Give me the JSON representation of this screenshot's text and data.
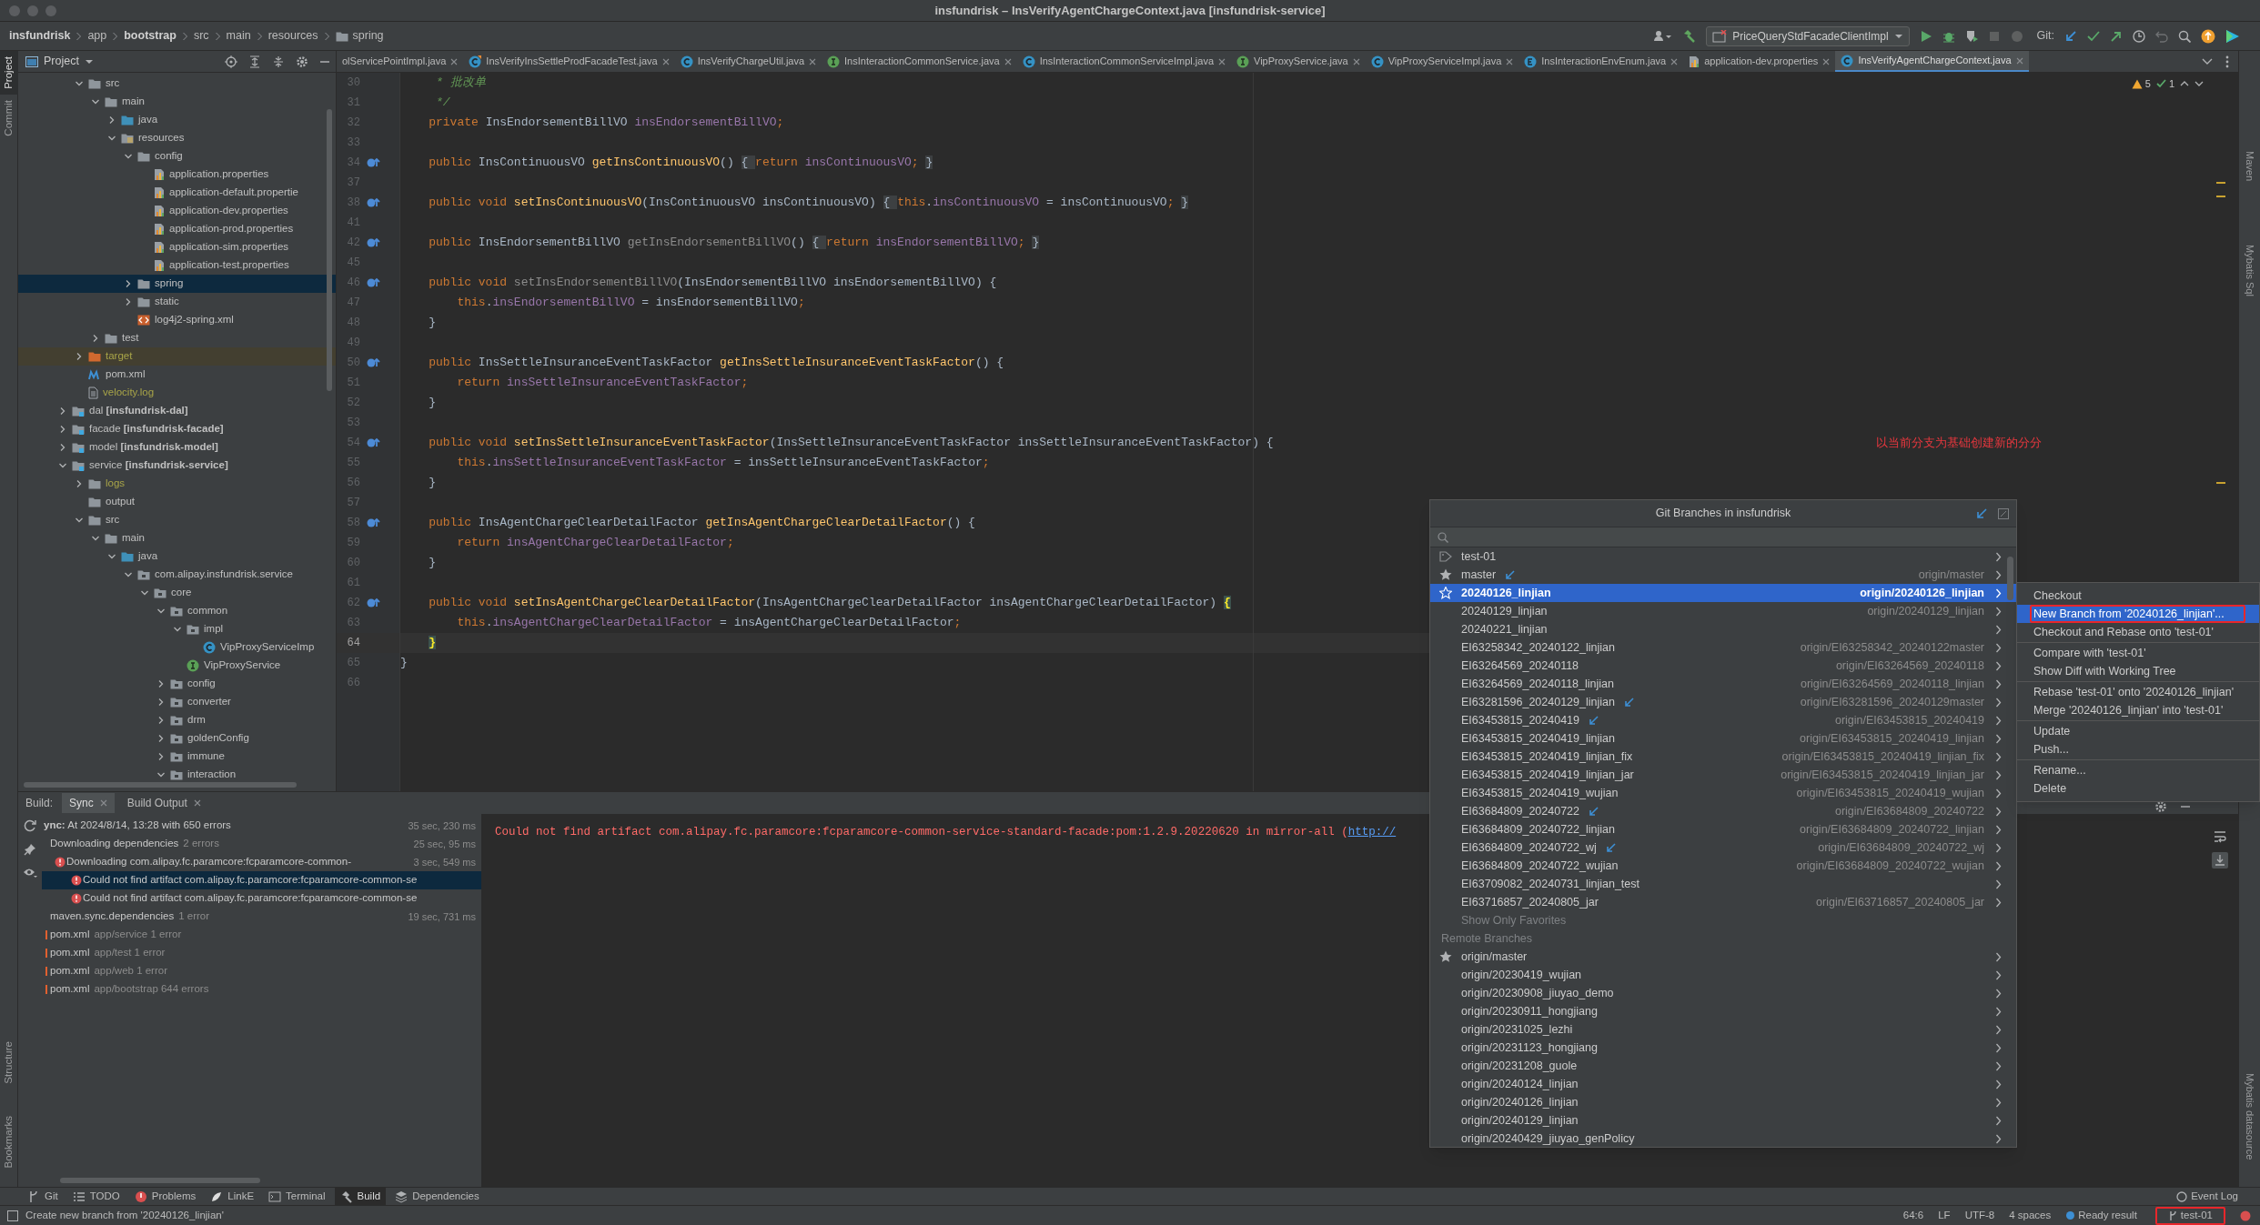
{
  "window": {
    "title": "insfundrisk – InsVerifyAgentChargeContext.java [insfundrisk-service]"
  },
  "breadcrumbs": [
    {
      "label": "insfundrisk",
      "bold": true,
      "kind": "text"
    },
    {
      "label": "app",
      "bold": false,
      "kind": "text"
    },
    {
      "label": "bootstrap",
      "bold": true,
      "kind": "text"
    },
    {
      "label": "src",
      "bold": false,
      "kind": "text"
    },
    {
      "label": "main",
      "bold": false,
      "kind": "text"
    },
    {
      "label": "resources",
      "bold": false,
      "kind": "text"
    },
    {
      "label": "spring",
      "bold": false,
      "kind": "folder"
    }
  ],
  "toolbar": {
    "run_configuration": "PriceQueryStdFacadeClientImpl",
    "git_label": "Git:"
  },
  "left_strip": [
    {
      "label": "Project",
      "selected": true
    },
    {
      "label": "Commit",
      "selected": false
    }
  ],
  "left_strip_bottom": [
    {
      "label": "Structure"
    },
    {
      "label": "Bookmarks"
    }
  ],
  "right_strip": [
    {
      "label": "Maven"
    },
    {
      "label": "Mybatis Sql"
    }
  ],
  "right_strip_bottom": [
    {
      "label": "Mybatis datasource"
    }
  ],
  "project_panel": {
    "title": "Project",
    "scrolled_parent_items": [
      {
        "label": "src",
        "kind": "folder",
        "expanded": true,
        "selected": false,
        "ignored": false,
        "children": [
          {
            "label": "main",
            "kind": "folder",
            "expanded": true,
            "selected": false,
            "ignored": false,
            "children": [
              {
                "label": "java",
                "kind": "source_folder",
                "expanded": false,
                "selected": false,
                "ignored": false
              },
              {
                "label": "resources",
                "kind": "resource_folder",
                "expanded": true,
                "selected": false,
                "ignored": false,
                "children": [
                  {
                    "label": "config",
                    "kind": "folder",
                    "expanded": true,
                    "selected": false,
                    "ignored": false,
                    "children": [
                      {
                        "label": "application.properties",
                        "kind": "properties",
                        "selected": false,
                        "ignored": false
                      },
                      {
                        "label": "application-default.propertie",
                        "kind": "properties",
                        "selected": false,
                        "ignored": false
                      },
                      {
                        "label": "application-dev.properties",
                        "kind": "properties",
                        "selected": false,
                        "ignored": false
                      },
                      {
                        "label": "application-prod.properties",
                        "kind": "properties",
                        "selected": false,
                        "ignored": false
                      },
                      {
                        "label": "application-sim.properties",
                        "kind": "properties",
                        "selected": false,
                        "ignored": false
                      },
                      {
                        "label": "application-test.properties",
                        "kind": "properties",
                        "selected": false,
                        "ignored": false
                      }
                    ]
                  },
                  {
                    "label": "spring",
                    "kind": "folder",
                    "expanded": false,
                    "selected": true,
                    "ignored": false
                  },
                  {
                    "label": "static",
                    "kind": "folder",
                    "expanded": false,
                    "selected": false,
                    "ignored": false
                  },
                  {
                    "label": "log4j2-spring.xml",
                    "kind": "xml",
                    "selected": false,
                    "ignored": false
                  }
                ]
              }
            ]
          },
          {
            "label": "test",
            "kind": "folder",
            "expanded": false,
            "selected": false,
            "ignored": false
          }
        ]
      },
      {
        "label": "target",
        "kind": "excluded_folder",
        "expanded": false,
        "selected": false,
        "ignored": true
      },
      {
        "label": "pom.xml",
        "kind": "maven",
        "selected": false,
        "ignored": false
      },
      {
        "label": "velocity.log",
        "kind": "log",
        "selected": false,
        "ignored": true
      }
    ],
    "items": [
      {
        "label": "dal **[insfundrisk-dal]**",
        "kind": "module",
        "expanded": false,
        "selected": false,
        "ignored": false
      },
      {
        "label": "facade **[insfundrisk-facade]**",
        "kind": "module",
        "expanded": false,
        "selected": false,
        "ignored": false
      },
      {
        "label": "model **[insfundrisk-model]**",
        "kind": "module",
        "expanded": false,
        "selected": false,
        "ignored": false
      },
      {
        "label": "service **[insfundrisk-service]**",
        "kind": "module",
        "expanded": true,
        "selected": false,
        "ignored": false,
        "children": [
          {
            "label": "logs",
            "kind": "folder",
            "expanded": false,
            "selected": false,
            "ignored": true
          },
          {
            "label": "output",
            "kind": "folder",
            "selected": false,
            "ignored": false
          },
          {
            "label": "src",
            "kind": "folder",
            "expanded": true,
            "selected": false,
            "ignored": false,
            "children": [
              {
                "label": "main",
                "kind": "folder",
                "expanded": true,
                "selected": false,
                "ignored": false,
                "children": [
                  {
                    "label": "java",
                    "kind": "source_folder",
                    "expanded": true,
                    "selected": false,
                    "ignored": false,
                    "children": [
                      {
                        "label": "com.alipay.insfundrisk.service",
                        "kind": "package",
                        "expanded": true,
                        "selected": false,
                        "ignored": false,
                        "children": [
                          {
                            "label": "core",
                            "kind": "package",
                            "expanded": true,
                            "selected": false,
                            "ignored": false,
                            "children": [
                              {
                                "label": "common",
                                "kind": "package",
                                "expanded": true,
                                "selected": false,
                                "ignored": false,
                                "children": [
                                  {
                                    "label": "impl",
                                    "kind": "package",
                                    "expanded": true,
                                    "selected": false,
                                    "ignored": false,
                                    "children": [
                                      {
                                        "label": "VipProxyServiceImp",
                                        "kind": "class",
                                        "selected": false,
                                        "ignored": false
                                      }
                                    ]
                                  },
                                  {
                                    "label": "VipProxyService",
                                    "kind": "interface",
                                    "selected": false,
                                    "ignored": false
                                  }
                                ]
                              },
                              {
                                "label": "config",
                                "kind": "package",
                                "expanded": false,
                                "selected": false,
                                "ignored": false
                              },
                              {
                                "label": "converter",
                                "kind": "package",
                                "expanded": false,
                                "selected": false,
                                "ignored": false
                              },
                              {
                                "label": "drm",
                                "kind": "package",
                                "expanded": false,
                                "selected": false,
                                "ignored": false
                              },
                              {
                                "label": "goldenConfig",
                                "kind": "package",
                                "expanded": false,
                                "selected": false,
                                "ignored": false
                              },
                              {
                                "label": "immune",
                                "kind": "package",
                                "expanded": false,
                                "selected": false,
                                "ignored": false
                              },
                              {
                                "label": "interaction",
                                "kind": "package",
                                "expanded": true,
                                "selected": false,
                                "ignored": false
                              }
                            ]
                          }
                        ]
                      }
                    ]
                  }
                ]
              }
            ]
          }
        ]
      }
    ]
  },
  "editor": {
    "tabs": [
      {
        "label": "olServicePointImpl.java",
        "kind": "none",
        "selected": false
      },
      {
        "label": "InsVerifyInsSettleProdFacadeTest.java",
        "kind": "test_class",
        "selected": false
      },
      {
        "label": "InsVerifyChargeUtil.java",
        "kind": "class",
        "selected": false
      },
      {
        "label": "InsInteractionCommonService.java",
        "kind": "interface",
        "selected": false
      },
      {
        "label": "InsInteractionCommonServiceImpl.java",
        "kind": "class",
        "selected": false
      },
      {
        "label": "VipProxyService.java",
        "kind": "interface",
        "selected": false
      },
      {
        "label": "VipProxyServiceImpl.java",
        "kind": "class",
        "selected": false
      },
      {
        "label": "InsInteractionEnvEnum.java",
        "kind": "enum",
        "selected": false
      },
      {
        "label": "application-dev.properties",
        "kind": "properties",
        "selected": false
      },
      {
        "label": "InsVerifyAgentChargeContext.java",
        "kind": "class",
        "selected": true
      }
    ],
    "inspections": {
      "warnings": "5",
      "passed": "1"
    },
    "lines": [
      {
        "n": "30",
        "marker": false,
        "current": false,
        "tokens": [
          {
            "kind": "c",
            "text": "     * 批改单"
          }
        ]
      },
      {
        "n": "31",
        "marker": false,
        "current": false,
        "tokens": [
          {
            "kind": "c",
            "text": "     */"
          }
        ]
      },
      {
        "n": "32",
        "marker": false,
        "current": false,
        "tokens": [
          {
            "kind": "k",
            "text": "    private "
          },
          {
            "kind": "t",
            "text": "InsEndorsementBillVO "
          },
          {
            "kind": "f",
            "text": "insEndorsementBillVO"
          },
          {
            "kind": "k",
            "text": ";"
          }
        ]
      },
      {
        "n": "33",
        "marker": false,
        "current": false
      },
      {
        "n": "34",
        "marker": true,
        "current": false,
        "tokens": [
          {
            "kind": "k",
            "text": "    public "
          },
          {
            "kind": "t",
            "text": "InsContinuousVO "
          },
          {
            "kind": "m",
            "text": "getInsContinuousVO"
          },
          {
            "kind": "t",
            "text": "() "
          },
          {
            "kind": "fb",
            "text": "{ "
          },
          {
            "kind": "k",
            "text": "return "
          },
          {
            "kind": "f",
            "text": "insContinuousVO"
          },
          {
            "kind": "k",
            "text": ";"
          },
          {
            "kind": "fb",
            "text": " }"
          }
        ]
      },
      {
        "n": "37",
        "marker": false,
        "current": false
      },
      {
        "n": "38",
        "marker": true,
        "current": false,
        "tokens": [
          {
            "kind": "k",
            "text": "    public void "
          },
          {
            "kind": "m",
            "text": "setInsContinuousVO"
          },
          {
            "kind": "t",
            "text": "(InsContinuousVO insContinuousVO) "
          },
          {
            "kind": "fb",
            "text": "{ "
          },
          {
            "kind": "k",
            "text": "this"
          },
          {
            "kind": "t",
            "text": "."
          },
          {
            "kind": "f",
            "text": "insContinuousVO"
          },
          {
            "kind": "t",
            "text": " = insContinuousVO"
          },
          {
            "kind": "k",
            "text": ";"
          },
          {
            "kind": "fb",
            "text": " }"
          }
        ]
      },
      {
        "n": "41",
        "marker": false,
        "current": false
      },
      {
        "n": "42",
        "marker": true,
        "current": false,
        "tokens": [
          {
            "kind": "k",
            "text": "    public "
          },
          {
            "kind": "t",
            "text": "InsEndorsementBillVO "
          },
          {
            "kind": "d",
            "text": "getInsEndorsementBillVO"
          },
          {
            "kind": "t",
            "text": "() "
          },
          {
            "kind": "fb",
            "text": "{ "
          },
          {
            "kind": "k",
            "text": "return "
          },
          {
            "kind": "f",
            "text": "insEndorsementBillVO"
          },
          {
            "kind": "k",
            "text": ";"
          },
          {
            "kind": "fb",
            "text": " }"
          }
        ]
      },
      {
        "n": "45",
        "marker": false,
        "current": false
      },
      {
        "n": "46",
        "marker": true,
        "current": false,
        "tokens": [
          {
            "kind": "k",
            "text": "    public void "
          },
          {
            "kind": "d",
            "text": "setInsEndorsementBillVO"
          },
          {
            "kind": "t",
            "text": "(InsEndorsementBillVO insEndorsementBillVO) {"
          }
        ]
      },
      {
        "n": "47",
        "marker": false,
        "current": false,
        "tokens": [
          {
            "kind": "k",
            "text": "        this"
          },
          {
            "kind": "t",
            "text": "."
          },
          {
            "kind": "f",
            "text": "insEndorsementBillVO"
          },
          {
            "kind": "t",
            "text": " = insEndorsementBillVO"
          },
          {
            "kind": "k",
            "text": ";"
          }
        ]
      },
      {
        "n": "48",
        "marker": false,
        "current": false,
        "tokens": [
          {
            "kind": "t",
            "text": "    }"
          }
        ]
      },
      {
        "n": "49",
        "marker": false,
        "current": false
      },
      {
        "n": "50",
        "marker": true,
        "current": false,
        "tokens": [
          {
            "kind": "k",
            "text": "    public "
          },
          {
            "kind": "t",
            "text": "InsSettleInsuranceEventTaskFactor "
          },
          {
            "kind": "m",
            "text": "getInsSettleInsuranceEventTaskFactor"
          },
          {
            "kind": "t",
            "text": "() {"
          }
        ]
      },
      {
        "n": "51",
        "marker": false,
        "current": false,
        "tokens": [
          {
            "kind": "k",
            "text": "        return "
          },
          {
            "kind": "f",
            "text": "insSettleInsuranceEventTaskFactor"
          },
          {
            "kind": "k",
            "text": ";"
          }
        ]
      },
      {
        "n": "52",
        "marker": false,
        "current": false,
        "tokens": [
          {
            "kind": "t",
            "text": "    }"
          }
        ]
      },
      {
        "n": "53",
        "marker": false,
        "current": false
      },
      {
        "n": "54",
        "marker": true,
        "current": false,
        "tokens": [
          {
            "kind": "k",
            "text": "    public void "
          },
          {
            "kind": "m",
            "text": "setInsSettleInsuranceEventTaskFactor"
          },
          {
            "kind": "t",
            "text": "(InsSettleInsuranceEventTaskFactor insSettleInsuranceEventTaskFactor) {"
          }
        ]
      },
      {
        "n": "55",
        "marker": false,
        "current": false,
        "tokens": [
          {
            "kind": "k",
            "text": "        this"
          },
          {
            "kind": "t",
            "text": "."
          },
          {
            "kind": "f",
            "text": "insSettleInsuranceEventTaskFactor"
          },
          {
            "kind": "t",
            "text": " = insSettleInsuranceEventTaskFactor"
          },
          {
            "kind": "k",
            "text": ";"
          }
        ]
      },
      {
        "n": "56",
        "marker": false,
        "current": false,
        "tokens": [
          {
            "kind": "t",
            "text": "    }"
          }
        ]
      },
      {
        "n": "57",
        "marker": false,
        "current": false
      },
      {
        "n": "58",
        "marker": true,
        "current": false,
        "tokens": [
          {
            "kind": "k",
            "text": "    public "
          },
          {
            "kind": "t",
            "text": "InsAgentChargeClearDetailFactor "
          },
          {
            "kind": "m",
            "text": "getInsAgentChargeClearDetailFactor"
          },
          {
            "kind": "t",
            "text": "() {"
          }
        ]
      },
      {
        "n": "59",
        "marker": false,
        "current": false,
        "tokens": [
          {
            "kind": "k",
            "text": "        return "
          },
          {
            "kind": "f",
            "text": "insAgentChargeClearDetailFactor"
          },
          {
            "kind": "k",
            "text": ";"
          }
        ]
      },
      {
        "n": "60",
        "marker": false,
        "current": false,
        "tokens": [
          {
            "kind": "t",
            "text": "    }"
          }
        ]
      },
      {
        "n": "61",
        "marker": false,
        "current": false
      },
      {
        "n": "62",
        "marker": true,
        "current": false,
        "tokens": [
          {
            "kind": "k",
            "text": "    public void "
          },
          {
            "kind": "m",
            "text": "setInsAgentChargeClearDetailFactor"
          },
          {
            "kind": "t",
            "text": "(InsAgentChargeClearDetailFactor insAgentChargeClearDetailFactor) "
          },
          {
            "kind": "hb",
            "text": "{"
          }
        ]
      },
      {
        "n": "63",
        "marker": false,
        "current": false,
        "tokens": [
          {
            "kind": "k",
            "text": "        this"
          },
          {
            "kind": "t",
            "text": "."
          },
          {
            "kind": "f",
            "text": "insAgentChargeClearDetailFactor"
          },
          {
            "kind": "t",
            "text": " = insAgentChargeClearDetailFactor"
          },
          {
            "kind": "k",
            "text": ";"
          }
        ]
      },
      {
        "n": "64",
        "marker": false,
        "current": true,
        "tokens": [
          {
            "kind": "hb",
            "text": "    }"
          }
        ]
      },
      {
        "n": "65",
        "marker": false,
        "current": false,
        "tokens": [
          {
            "kind": "t",
            "text": "}"
          }
        ]
      },
      {
        "n": "66",
        "marker": false,
        "current": false
      }
    ],
    "annotation": "以当前分支为基础创建新的分分"
  },
  "build": {
    "label": "Build:",
    "tabs": [
      {
        "label": "Sync",
        "selected": true
      },
      {
        "label": "Build Output",
        "selected": false
      }
    ],
    "tree": [
      {
        "label": "**ync:** At 2024/8/14, 13:28 with 650 errors",
        "time": "35 sec, 230 ms",
        "kind": "plain",
        "selected": false,
        "children": [
          {
            "label": "Downloading dependencies",
            "detail": "2 errors",
            "time": "25 sec, 95 ms",
            "kind": "plain",
            "selected": false,
            "children": [
              {
                "label": "Downloading com.alipay.fc.paramcore:fcparamcore-common-",
                "time": "3 sec, 549 ms",
                "kind": "error",
                "selected": false,
                "children": [
                  {
                    "label": "Could not find artifact com.alipay.fc.paramcore:fcparamcore-common-se",
                    "kind": "error",
                    "selected": true
                  },
                  {
                    "label": "Could not find artifact com.alipay.fc.paramcore:fcparamcore-common-se",
                    "kind": "error",
                    "selected": false
                  }
                ]
              }
            ]
          },
          {
            "label": "maven.sync.dependencies",
            "detail": "1 error",
            "time": "19 sec, 731 ms",
            "kind": "plain",
            "selected": false
          },
          {
            "label": "pom.xml",
            "detail": "app/service 1 error",
            "kind": "problem_file",
            "selected": false
          },
          {
            "label": "pom.xml",
            "detail": "app/test 1 error",
            "kind": "problem_file",
            "selected": false
          },
          {
            "label": "pom.xml",
            "detail": "app/web 1 error",
            "kind": "problem_file",
            "selected": false
          },
          {
            "label": "pom.xml",
            "detail": "app/bootstrap 644 errors",
            "kind": "problem_file",
            "selected": false
          }
        ]
      }
    ],
    "console": {
      "message": "Could not find artifact com.alipay.fc.paramcore:fcparamcore-common-service-standard-facade:pom:1.2.9.20220620 in mirror-all (",
      "link": "http://"
    }
  },
  "git_branches_popup": {
    "title": "Git Branches in insfundrisk",
    "local": [
      {
        "label": "test-01",
        "kind": "current",
        "incoming": false,
        "selected": false
      },
      {
        "label": "master",
        "kind": "favorite",
        "incoming": true,
        "tracking": "origin/master",
        "selected": false
      },
      {
        "label": "20240126_linjian",
        "kind": "star_outline",
        "incoming": false,
        "tracking": "origin/20240126_linjian",
        "selected": true
      },
      {
        "label": "20240129_linjian",
        "kind": "plain",
        "incoming": false,
        "tracking": "origin/20240129_linjian",
        "selected": false
      },
      {
        "label": "20240221_linjian",
        "kind": "plain",
        "incoming": false,
        "selected": false
      },
      {
        "label": "EI63258342_20240122_linjian",
        "kind": "plain",
        "incoming": false,
        "tracking": "origin/EI63258342_20240122master",
        "selected": false
      },
      {
        "label": "EI63264569_20240118",
        "kind": "plain",
        "incoming": false,
        "tracking": "origin/EI63264569_20240118",
        "selected": false
      },
      {
        "label": "EI63264569_20240118_linjian",
        "kind": "plain",
        "incoming": false,
        "tracking": "origin/EI63264569_20240118_linjian",
        "selected": false
      },
      {
        "label": "EI63281596_20240129_linjian",
        "kind": "plain",
        "incoming": true,
        "tracking": "origin/EI63281596_20240129master",
        "selected": false
      },
      {
        "label": "EI63453815_20240419",
        "kind": "plain",
        "incoming": true,
        "tracking": "origin/EI63453815_20240419",
        "selected": false
      },
      {
        "label": "EI63453815_20240419_linjian",
        "kind": "plain",
        "incoming": false,
        "tracking": "origin/EI63453815_20240419_linjian",
        "selected": false
      },
      {
        "label": "EI63453815_20240419_linjian_fix",
        "kind": "plain",
        "incoming": false,
        "tracking": "origin/EI63453815_20240419_linjian_fix",
        "selected": false
      },
      {
        "label": "EI63453815_20240419_linjian_jar",
        "kind": "plain",
        "incoming": false,
        "tracking": "origin/EI63453815_20240419_linjian_jar",
        "selected": false
      },
      {
        "label": "EI63453815_20240419_wujian",
        "kind": "plain",
        "incoming": false,
        "tracking": "origin/EI63453815_20240419_wujian",
        "selected": false
      },
      {
        "label": "EI63684809_20240722",
        "kind": "plain",
        "incoming": true,
        "tracking": "origin/EI63684809_20240722",
        "selected": false
      },
      {
        "label": "EI63684809_20240722_linjian",
        "kind": "plain",
        "incoming": false,
        "tracking": "origin/EI63684809_20240722_linjian",
        "selected": false
      },
      {
        "label": "EI63684809_20240722_wj",
        "kind": "plain",
        "incoming": true,
        "tracking": "origin/EI63684809_20240722_wj",
        "selected": false
      },
      {
        "label": "EI63684809_20240722_wujian",
        "kind": "plain",
        "incoming": false,
        "tracking": "origin/EI63684809_20240722_wujian",
        "selected": false
      },
      {
        "label": "EI63709082_20240731_linjian_test",
        "kind": "plain",
        "incoming": false,
        "selected": false
      },
      {
        "label": "EI63716857_20240805_jar",
        "kind": "plain",
        "incoming": false,
        "tracking": "origin/EI63716857_20240805_jar",
        "selected": false
      }
    ],
    "show_only_favorites": "Show Only Favorites",
    "remote_header": "Remote Branches",
    "remote": [
      {
        "label": "origin/master",
        "kind": "favorite",
        "selected": false
      },
      {
        "label": "origin/20230419_wujian",
        "kind": "plain",
        "selected": false
      },
      {
        "label": "origin/20230908_jiuyao_demo",
        "kind": "plain",
        "selected": false
      },
      {
        "label": "origin/20230911_hongjiang",
        "kind": "plain",
        "selected": false
      },
      {
        "label": "origin/20231025_lezhi",
        "kind": "plain",
        "selected": false
      },
      {
        "label": "origin/20231123_hongjiang",
        "kind": "plain",
        "selected": false
      },
      {
        "label": "origin/20231208_guole",
        "kind": "plain",
        "selected": false
      },
      {
        "label": "origin/20240124_linjian",
        "kind": "plain",
        "selected": false
      },
      {
        "label": "origin/20240126_linjian",
        "kind": "plain",
        "selected": false
      },
      {
        "label": "origin/20240129_linjian",
        "kind": "plain",
        "selected": false
      },
      {
        "label": "origin/20240429_jiuyao_genPolicy",
        "kind": "plain",
        "selected": false
      }
    ]
  },
  "branch_menu": [
    {
      "kind": "item",
      "label": "Checkout",
      "selected": false,
      "annotated": false
    },
    {
      "kind": "item",
      "label": "New Branch from '20240126_linjian'...",
      "selected": true,
      "annotated": true
    },
    {
      "kind": "item",
      "label": "Checkout and Rebase onto 'test-01'",
      "selected": false,
      "annotated": false
    },
    {
      "kind": "separator"
    },
    {
      "kind": "item",
      "label": "Compare with 'test-01'",
      "selected": false,
      "annotated": false
    },
    {
      "kind": "item",
      "label": "Show Diff with Working Tree",
      "selected": false,
      "annotated": false
    },
    {
      "kind": "separator"
    },
    {
      "kind": "item",
      "label": "Rebase 'test-01' onto '20240126_linjian'",
      "selected": false,
      "annotated": false
    },
    {
      "kind": "item",
      "label": "Merge '20240126_linjian' into 'test-01'",
      "selected": false,
      "annotated": false
    },
    {
      "kind": "separator"
    },
    {
      "kind": "item",
      "label": "Update",
      "selected": false,
      "annotated": false
    },
    {
      "kind": "item",
      "label": "Push...",
      "selected": false,
      "annotated": false
    },
    {
      "kind": "separator"
    },
    {
      "kind": "item",
      "label": "Rename...",
      "selected": false,
      "annotated": false
    },
    {
      "kind": "item",
      "label": "Delete",
      "selected": false,
      "annotated": false
    }
  ],
  "tool_windows": [
    {
      "label": "Git",
      "kind": "git",
      "selected": false
    },
    {
      "label": "TODO",
      "kind": "list",
      "selected": false
    },
    {
      "label": "Problems",
      "kind": "problems",
      "selected": false
    },
    {
      "label": "LinkE",
      "kind": "link",
      "selected": false
    },
    {
      "label": "Terminal",
      "kind": "terminal",
      "selected": false
    },
    {
      "label": "Build",
      "kind": "build",
      "selected": true
    },
    {
      "label": "Dependencies",
      "kind": "layers",
      "selected": false
    }
  ],
  "event_log": "Event Log",
  "status_bar": {
    "message": "Create new branch from '20240126_linjian'",
    "position": "64:6",
    "line_separator": "LF",
    "encoding": "UTF-8",
    "indent": "4 spaces",
    "ready": "Ready result",
    "branch": "test-01",
    "branch_annotated": true
  }
}
